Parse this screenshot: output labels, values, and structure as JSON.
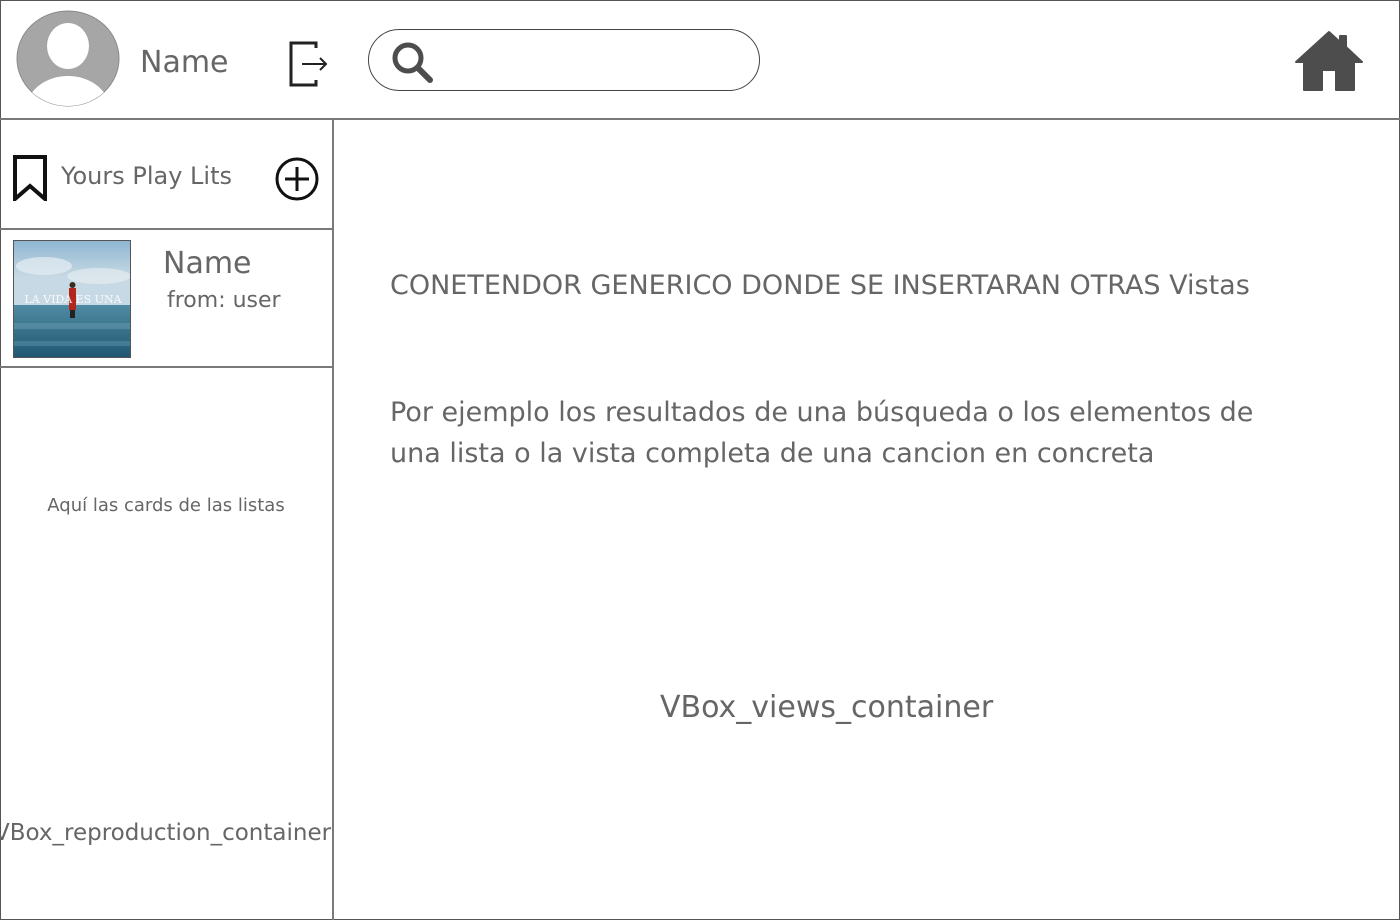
{
  "header": {
    "user_name": "Name",
    "search": {
      "value": "",
      "placeholder": ""
    },
    "icons": [
      "avatar-icon",
      "logout-icon",
      "search-icon",
      "home-icon"
    ]
  },
  "sidebar": {
    "playlists_title": "Yours Play Lits",
    "playlist_card": {
      "name": "Name",
      "from": "from: user",
      "cover_text": "LA VIDA ES UNA"
    },
    "cards_note": "Aquí las cards de las listas",
    "reproduction_container": "VBox_reproduction_container"
  },
  "main": {
    "heading": "CONETENDOR GENERICO DONDE SE INSERTARAN OTRAS Vistas",
    "description": "Por ejemplo los resultados de una búsqueda o los elementos de una lista o la vista completa de una cancion en concreta",
    "container_label": "VBox_views_container"
  },
  "colors": {
    "text": "#666666",
    "border": "#7a7a7a",
    "icon": "#4d4d4d",
    "avatar_bg": "#a6a6a6"
  }
}
